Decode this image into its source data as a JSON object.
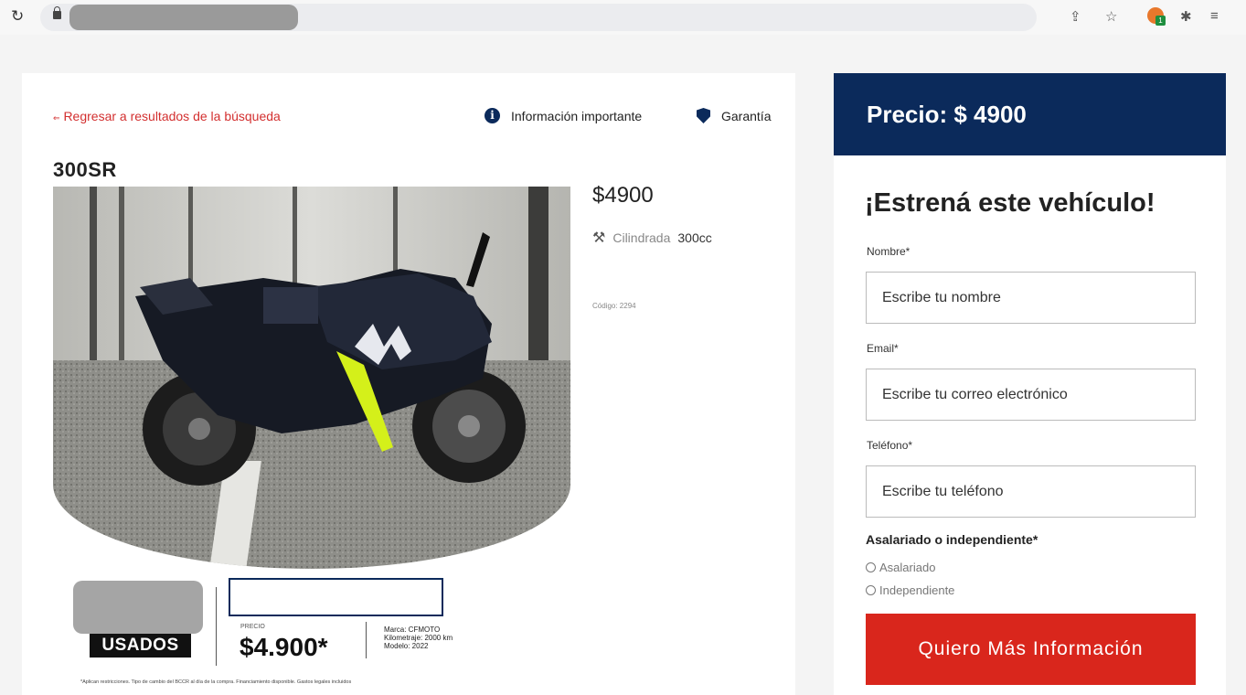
{
  "browser": {
    "icons": [
      "reload-icon",
      "lock-icon",
      "share-icon",
      "star-icon",
      "extension-icon",
      "puzzle-icon",
      "reading-list-icon"
    ],
    "extension_badge": "1"
  },
  "nav": {
    "back_link": "Regresar a resultados de la búsqueda",
    "info_link": "Información importante",
    "warranty_link": "Garantía"
  },
  "listing": {
    "model": "300SR",
    "price": "$4900",
    "cc_label": "Cilindrada",
    "cc_value": "300cc",
    "code": "Código: 2294"
  },
  "banner": {
    "tag": "USADOS",
    "precio_label": "PRECIO",
    "precio_value": "$4.900*",
    "marca": "Marca: CFMOTO",
    "kilometraje": "Kilometraje: 2000 km",
    "modelo": "Modelo: 2022",
    "disclaimer": "*Aplican restricciones. Tipo de cambio del BCCR al día de la compra. Financiamiento disponible. Gastos legales incluidos"
  },
  "form": {
    "price_header": "Precio: $ 4900",
    "title": "¡Estrená este vehículo!",
    "name_label": "Nombre*",
    "name_placeholder": "Escribe tu nombre",
    "email_label": "Email*",
    "email_placeholder": "Escribe tu correo electrónico",
    "phone_label": "Teléfono*",
    "phone_placeholder": "Escribe tu teléfono",
    "employment_label": "Asalariado o independiente*",
    "option_1": "Asalariado",
    "option_2": "Independiente",
    "submit": "Quiero Más Información"
  },
  "colors": {
    "navy": "#0b2a5b",
    "red": "#d9261c"
  }
}
